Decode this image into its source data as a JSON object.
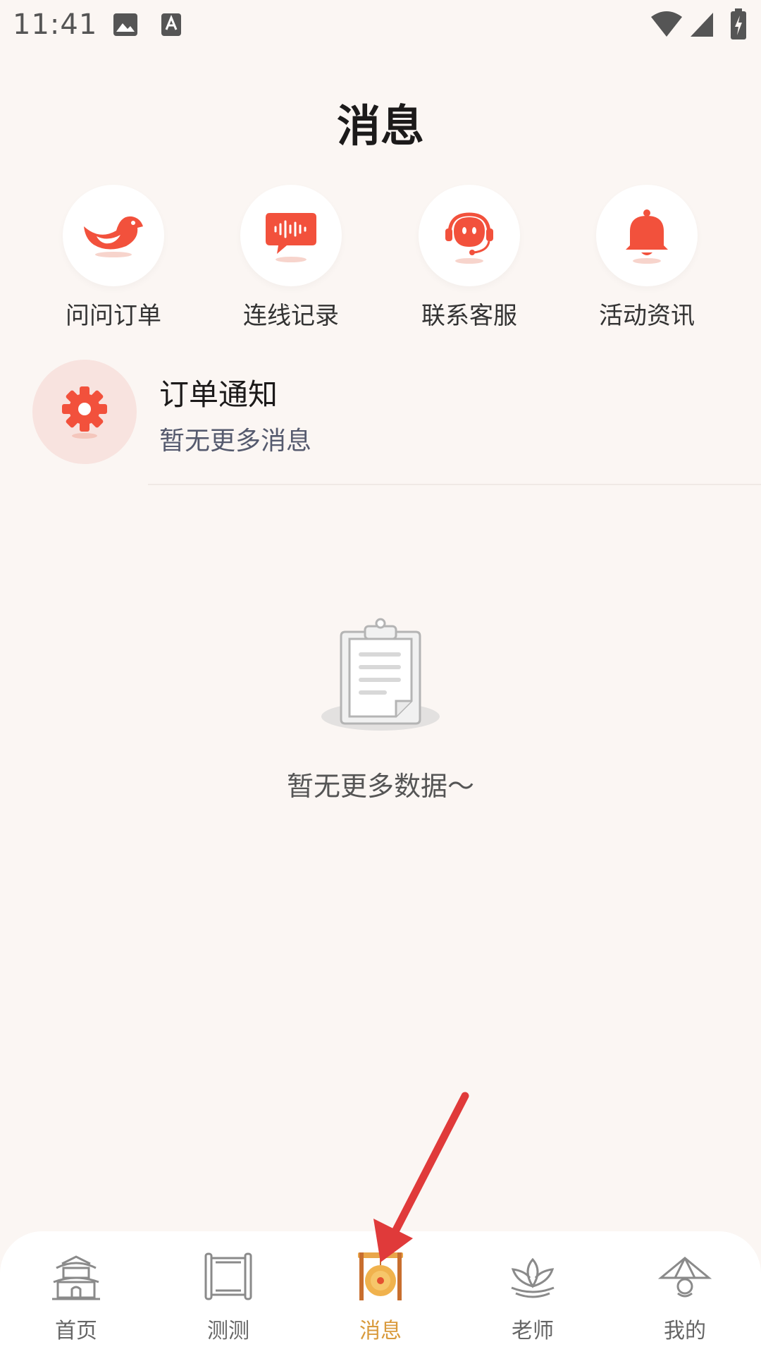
{
  "status_bar": {
    "time": "11:41"
  },
  "page": {
    "title": "消息"
  },
  "quick_actions": [
    {
      "label": "问问订单",
      "icon": "bird-icon"
    },
    {
      "label": "连线记录",
      "icon": "voice-chat-icon"
    },
    {
      "label": "联系客服",
      "icon": "headset-icon"
    },
    {
      "label": "活动资讯",
      "icon": "bell-icon"
    }
  ],
  "order_notice": {
    "title": "订单通知",
    "subtitle": "暂无更多消息"
  },
  "empty_state": {
    "text": "暂无更多数据～"
  },
  "tabs": [
    {
      "label": "首页",
      "icon": "palace-icon",
      "active": false
    },
    {
      "label": "测测",
      "icon": "scroll-icon",
      "active": false
    },
    {
      "label": "消息",
      "icon": "gong-icon",
      "active": true
    },
    {
      "label": "老师",
      "icon": "lotus-icon",
      "active": false
    },
    {
      "label": "我的",
      "icon": "hat-icon",
      "active": false
    }
  ],
  "colors": {
    "accent_red": "#f2513c",
    "active_tab": "#d99a3c",
    "background": "#fbf6f3"
  }
}
